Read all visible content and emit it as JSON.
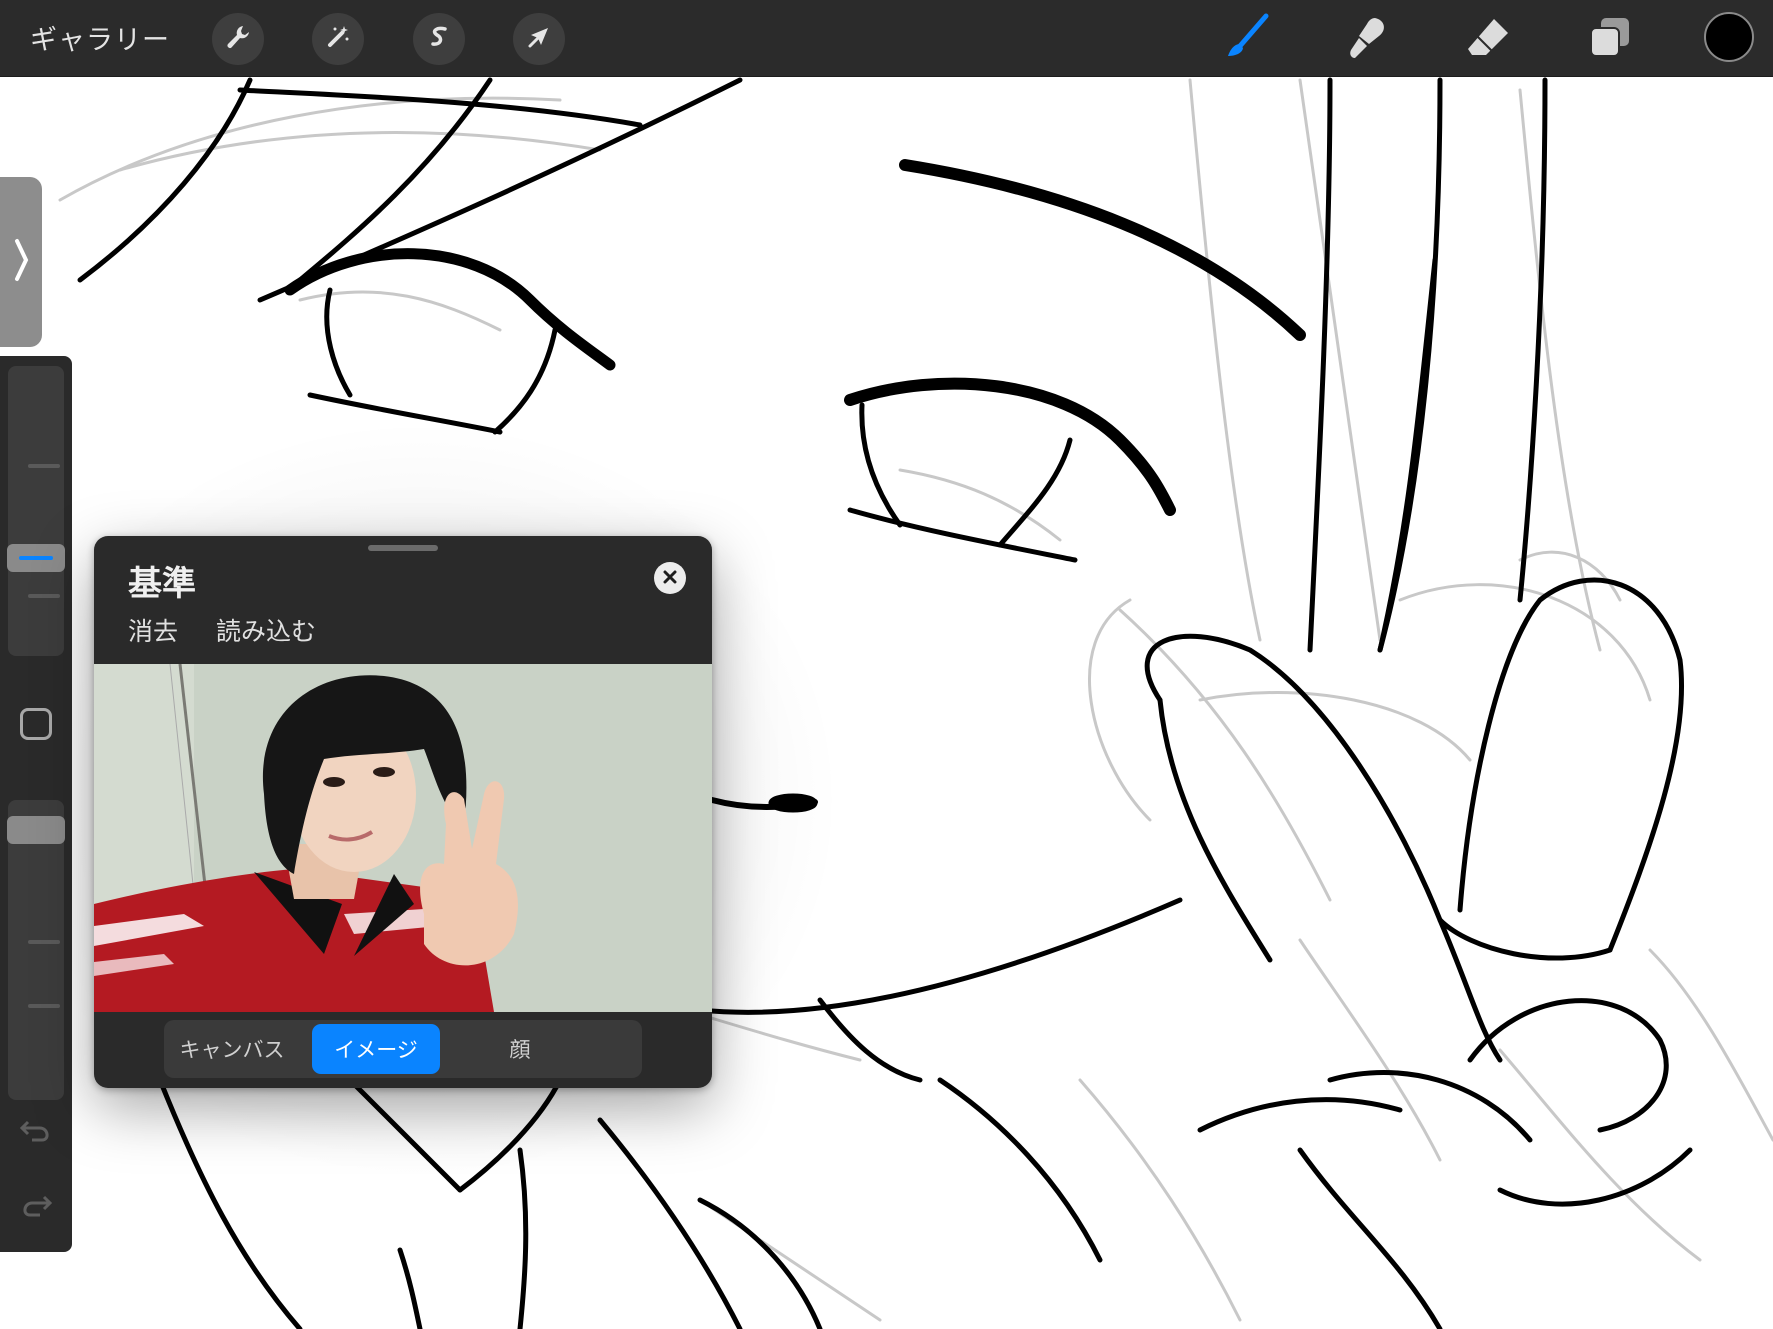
{
  "toolbar": {
    "gallery_label": "ギャラリー",
    "actions_icon": "wrench-icon",
    "adjustments_icon": "magic-wand-icon",
    "selection_icon": "selection-s-icon",
    "transform_icon": "arrow-cursor-icon",
    "brush_icon": "brush-icon",
    "smudge_icon": "smudge-icon",
    "eraser_icon": "eraser-icon",
    "layers_icon": "layers-icon",
    "current_color": "#000000",
    "active_tool_color": "#0a84ff"
  },
  "sidebar": {
    "brush_size_level": 0.32,
    "opacity_level": 0.06,
    "undo_icon": "undo-icon",
    "redo_icon": "redo-icon"
  },
  "reference_panel": {
    "title": "基準",
    "clear_label": "消去",
    "import_label": "読み込む",
    "tabs": [
      {
        "label": "キャンバス",
        "active": false
      },
      {
        "label": "イメージ",
        "active": true
      },
      {
        "label": "顔",
        "active": false
      }
    ]
  }
}
